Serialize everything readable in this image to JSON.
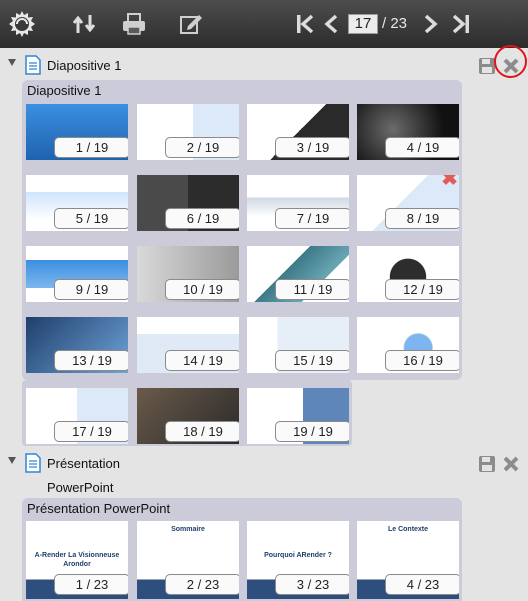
{
  "toolbar": {
    "icons": [
      "app-logo-icon",
      "sort-icon",
      "print-icon",
      "edit-icon",
      "first-page-icon",
      "previous-page-icon",
      "next-page-icon",
      "last-page-icon"
    ],
    "current_page": "17",
    "total_pages": "/ 23"
  },
  "documents": [
    {
      "title": "Diapositive 1",
      "group_title": "Diapositive 1",
      "slides": [
        {
          "label": "1 / 19",
          "style": "logo-blue"
        },
        {
          "label": "2 / 19",
          "style": "table-of-contents"
        },
        {
          "label": "3 / 19",
          "style": "document-viewing"
        },
        {
          "label": "4 / 19",
          "style": "features-dark"
        },
        {
          "label": "5 / 19",
          "style": "blue-arrows"
        },
        {
          "label": "6 / 19",
          "style": "devices"
        },
        {
          "label": "7 / 19",
          "style": "integrations"
        },
        {
          "label": "8 / 19",
          "style": "rocket"
        },
        {
          "label": "9 / 19",
          "style": "ease-of-use"
        },
        {
          "label": "10 / 19",
          "style": "gear-photo"
        },
        {
          "label": "11 / 19",
          "style": "customer-benefits"
        },
        {
          "label": "12 / 19",
          "style": "key-figures"
        },
        {
          "label": "13 / 19",
          "style": "buildings"
        },
        {
          "label": "14 / 19",
          "style": "architecture"
        },
        {
          "label": "15 / 19",
          "style": "client-side"
        },
        {
          "label": "16 / 19",
          "style": "scalability"
        },
        {
          "label": "17 / 19",
          "style": "integrative-apis"
        },
        {
          "label": "18 / 19",
          "style": "laptop-photo"
        },
        {
          "label": "19 / 19",
          "style": "contact-us"
        }
      ]
    },
    {
      "title_line1": "Présentation",
      "title_line2": "PowerPoint",
      "group_title": "Présentation PowerPoint",
      "slides": [
        {
          "label": "1 / 23",
          "heading": "A-Render La Visionneuse Arondor"
        },
        {
          "label": "2 / 23",
          "heading": "Sommaire"
        },
        {
          "label": "3 / 23",
          "heading": "Pourquoi ARender ?"
        },
        {
          "label": "4 / 23",
          "heading": "Le Contexte"
        }
      ]
    }
  ],
  "colors": {
    "accent_blue": "#2f86d6",
    "close_highlight": "#e0151b",
    "group_background": "#cbcbd9"
  }
}
